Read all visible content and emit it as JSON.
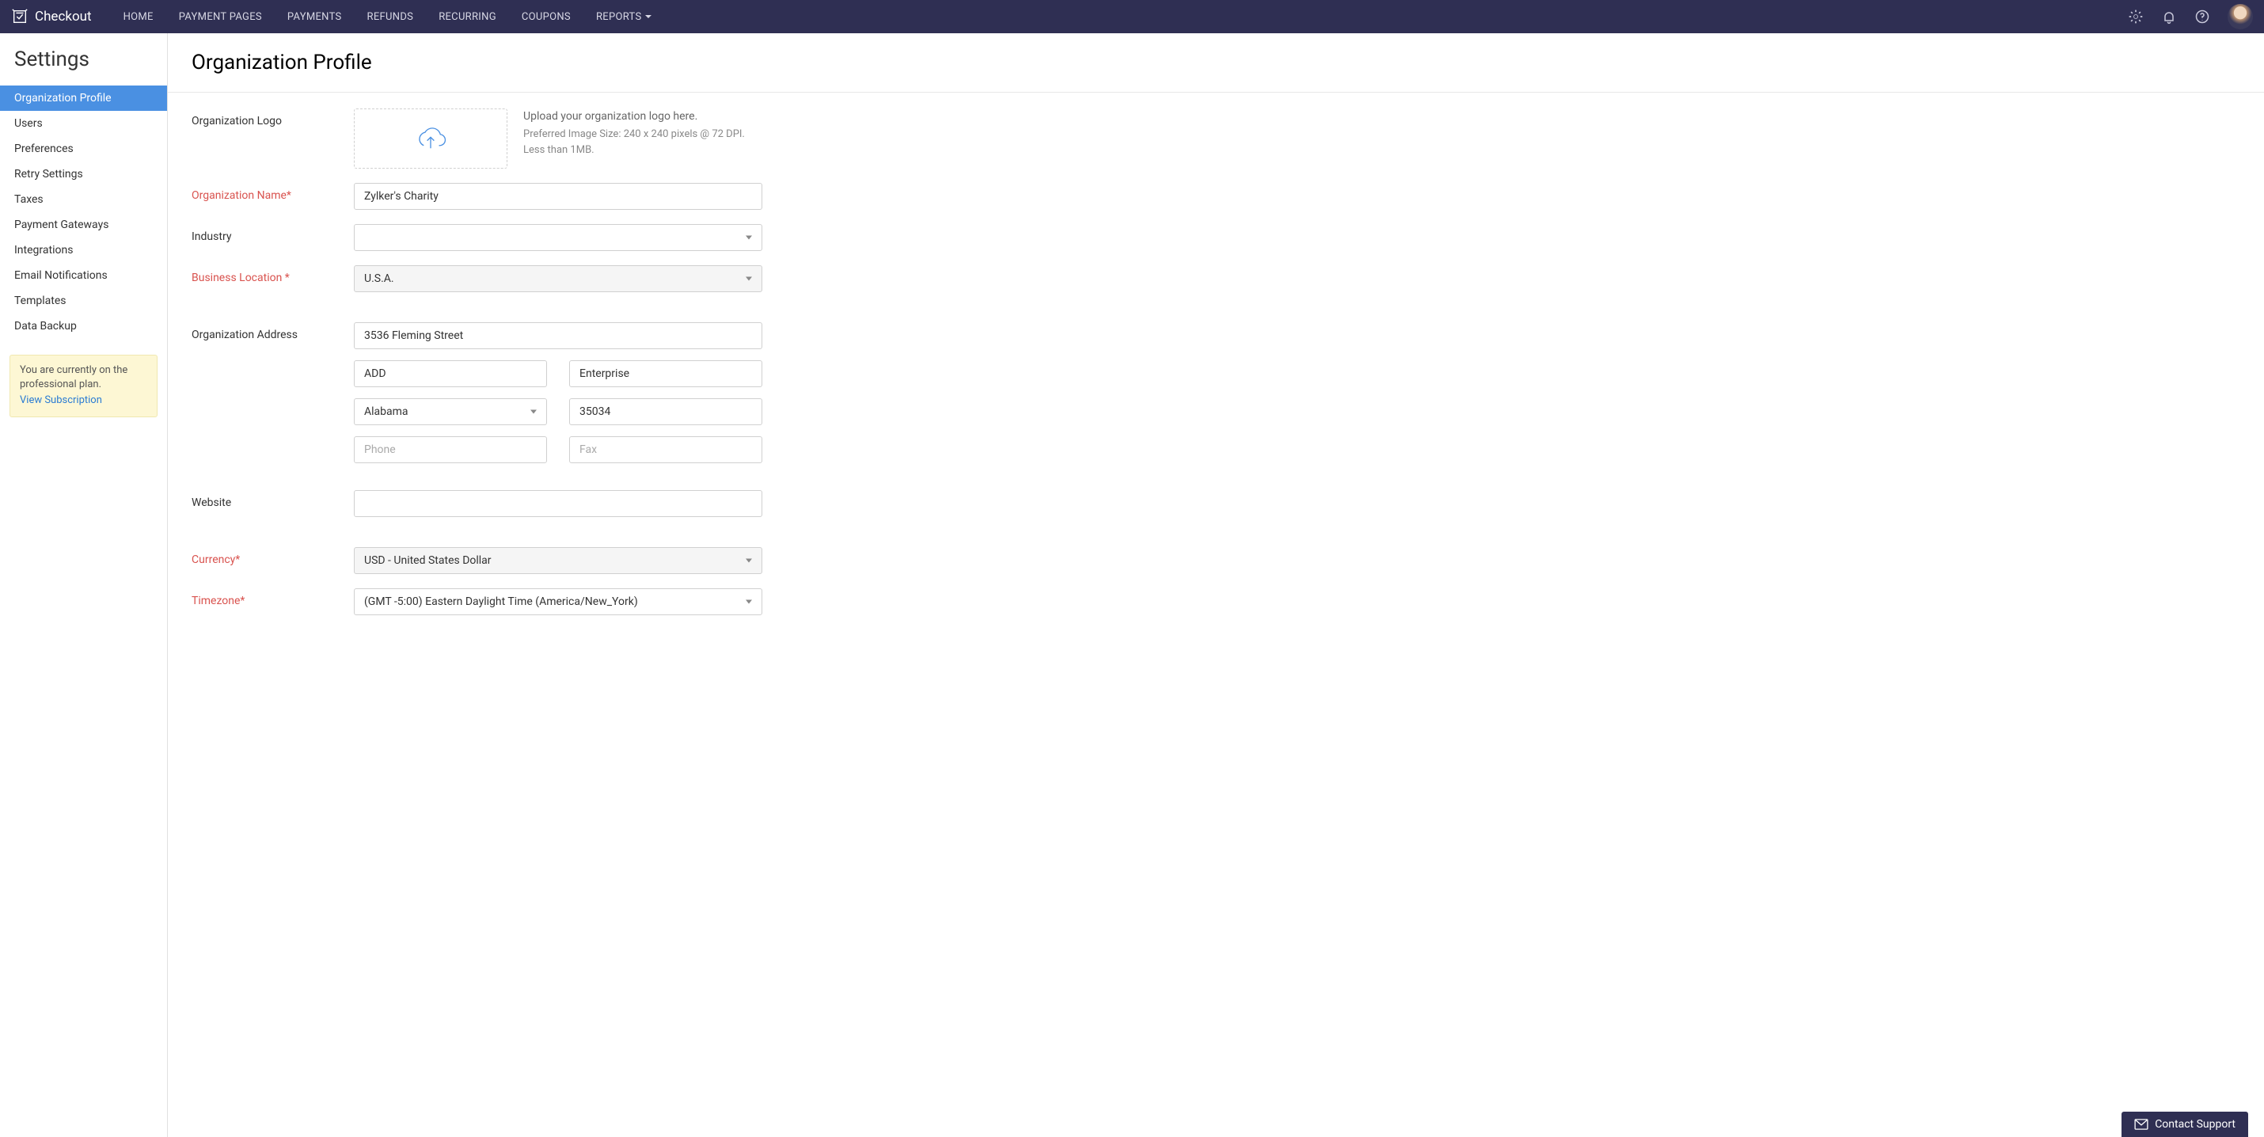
{
  "app": {
    "name": "Checkout"
  },
  "nav": [
    "HOME",
    "PAYMENT PAGES",
    "PAYMENTS",
    "REFUNDS",
    "RECURRING",
    "COUPONS",
    "REPORTS"
  ],
  "sidebar": {
    "title": "Settings",
    "items": [
      "Organization Profile",
      "Users",
      "Preferences",
      "Retry Settings",
      "Taxes",
      "Payment Gateways",
      "Integrations",
      "Email Notifications",
      "Templates",
      "Data Backup"
    ],
    "plan": {
      "text": "You are currently on the professional plan.",
      "link": "View Subscription"
    }
  },
  "page": {
    "title": "Organization Profile"
  },
  "form": {
    "logoLabel": "Organization Logo",
    "uploadTitle": "Upload your organization logo here.",
    "uploadLine2": "Preferred Image Size: 240 x 240 pixels @ 72 DPI.",
    "uploadLine3": "Less than 1MB.",
    "orgNameLabel": "Organization Name*",
    "orgNameValue": "Zylker's Charity",
    "industryLabel": "Industry",
    "industryValue": "",
    "bizLocLabel": "Business Location *",
    "bizLocValue": "U.S.A.",
    "addrLabel": "Organization Address",
    "addrStreet": "3536 Fleming Street",
    "addrLine2": "ADD",
    "addrCity": "Enterprise",
    "addrState": "Alabama",
    "addrZip": "35034",
    "phonePh": "Phone",
    "faxPh": "Fax",
    "websiteLabel": "Website",
    "websiteValue": "",
    "currencyLabel": "Currency*",
    "currencyValue": "USD - United States Dollar",
    "tzLabel": "Timezone*",
    "tzValue": "(GMT -5:00) Eastern Daylight Time (America/New_York)"
  },
  "support": "Contact Support"
}
